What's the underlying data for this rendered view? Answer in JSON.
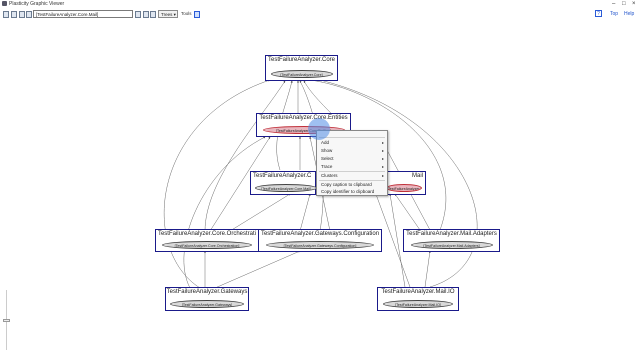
{
  "window": {
    "title": "Plasticity Graphic Viewer"
  },
  "toolbar": {
    "breadcrumb_value": "[TestFailureAnalyzer.Core.Mail]",
    "trees_label": "Trees",
    "tools_label": "Tools",
    "top_label": "Top",
    "help_label": "Help"
  },
  "nodes": {
    "core": {
      "title": "TestFailureAnalyzer.Core",
      "ellipse": "[TestFailureAnalyzer.Core]"
    },
    "entities": {
      "title": "TestFailureAnalyzer.Core.Entities",
      "ellipse": "[TestFailureAnalyzer.Core.Entities]"
    },
    "mid": {
      "title": "TestFailureAnalyzer.C",
      "ellipse": "[TestFailureAnalyzer.Core.Mail]"
    },
    "mail": {
      "title": "Mail",
      "ellipse": "[TestFailureAnalyzer.Mail]"
    },
    "orchestrat": {
      "title": "TestFailureAnalyzer.Core.Orchestrati",
      "ellipse": "[TestFailureAnalyzer.Core.Orchestration]"
    },
    "gwconfig": {
      "title": "TestFailureAnalyzer.Gateways.Configuration",
      "ellipse": "[TestFailureAnalyzer.Gateways.Configuration]"
    },
    "mailadapters": {
      "title": "TestFailureAnalyzer.Mail.Adapters",
      "ellipse": "[TestFailureAnalyzer.Mail.Adapters]"
    },
    "gateways": {
      "title": "TestFailureAnalyzer.Gateways",
      "ellipse": "[TestFailureAnalyzer.Gateways]"
    },
    "mailio": {
      "title": "TestFailureAnalyzer.Mail.IO",
      "ellipse": "[TestFailureAnalyzer.Mail.IO]"
    }
  },
  "context_menu": {
    "items": [
      "Add",
      "Show",
      "Select",
      "Trace",
      "Clusters",
      "Copy caption to clipboard",
      "Copy identifier to clipboard"
    ],
    "submenu_arrow": "▸"
  },
  "colors": {
    "node_border": "#1a1a8a",
    "selected_ellipse": "#e9b7bf",
    "edge": "#555555"
  }
}
